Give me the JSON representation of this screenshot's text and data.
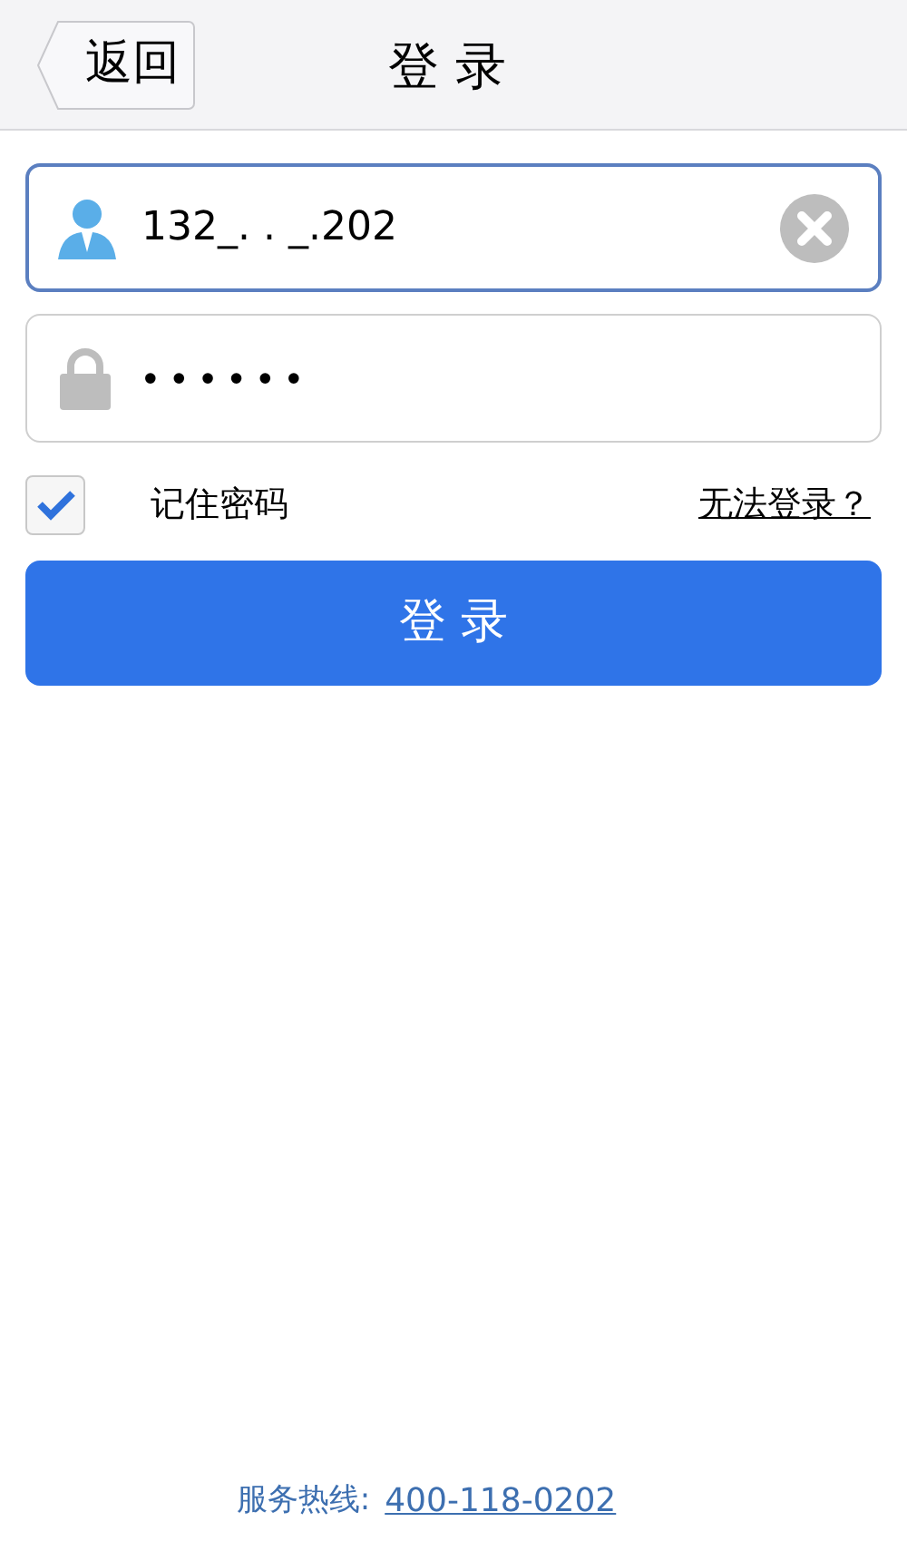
{
  "header": {
    "back": "返回",
    "title": "登 录"
  },
  "username": {
    "value": "132_. . _.202"
  },
  "password": {
    "value": "••••••"
  },
  "remember": {
    "label": "记住密码",
    "checked": true
  },
  "forgot": "无法登录？",
  "login_button": "登 录",
  "footer": {
    "label": "服务热线:",
    "phone": "400-118-0202"
  }
}
